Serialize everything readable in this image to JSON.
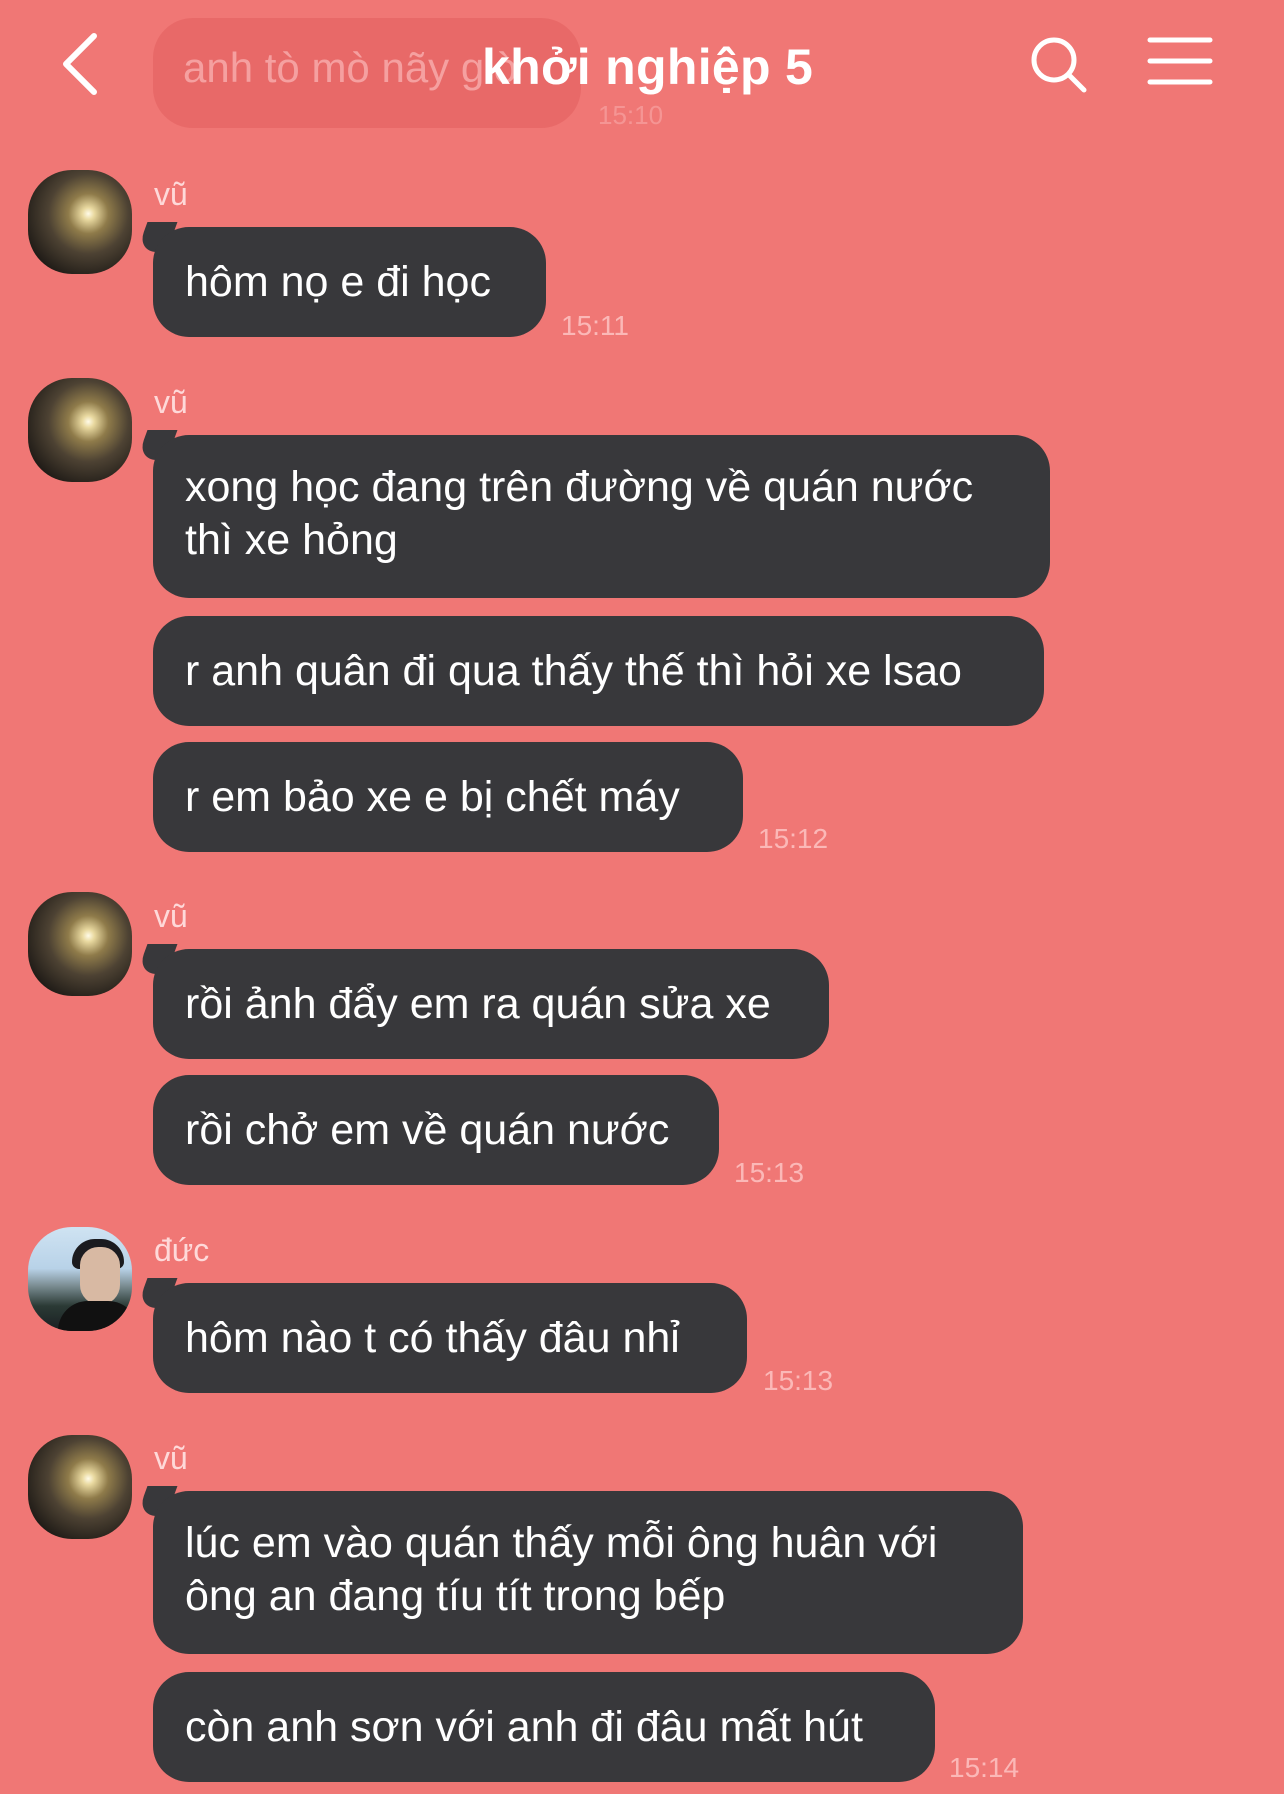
{
  "header": {
    "title": "khởi nghiệp 5",
    "ghost_message": "anh tò mò nãy giờ",
    "ghost_time": "15:10",
    "back_icon": "chevron-left-icon",
    "search_icon": "search-icon",
    "menu_icon": "hamburger-menu-icon"
  },
  "colors": {
    "background": "#f07775",
    "bubble": "#38383b",
    "text": "#ffffff"
  },
  "messages": [
    {
      "sender": "vũ",
      "bubbles": [
        "hôm nọ e đi học"
      ],
      "time": "15:11"
    },
    {
      "sender": "vũ",
      "bubbles": [
        "xong học đang trên đường về quán nước",
        "thì xe hỏng",
        "r anh quân đi qua thấy thế thì hỏi xe lsao",
        "r em bảo xe e bị chết máy"
      ],
      "time": "15:12"
    },
    {
      "sender": "vũ",
      "bubbles": [
        "rồi ảnh đẩy em ra quán sửa xe",
        "rồi chở em về quán nước"
      ],
      "time": "15:13"
    },
    {
      "sender": "đức",
      "bubbles": [
        "hôm nào t có thấy đâu nhỉ"
      ],
      "time": "15:13"
    },
    {
      "sender": "vũ",
      "bubbles": [
        "lúc em vào quán thấy mỗi ông huân với",
        "ông an đang tíu tít trong bếp",
        "còn anh sơn với anh đi đâu mất hút"
      ],
      "time": "15:14"
    }
  ]
}
